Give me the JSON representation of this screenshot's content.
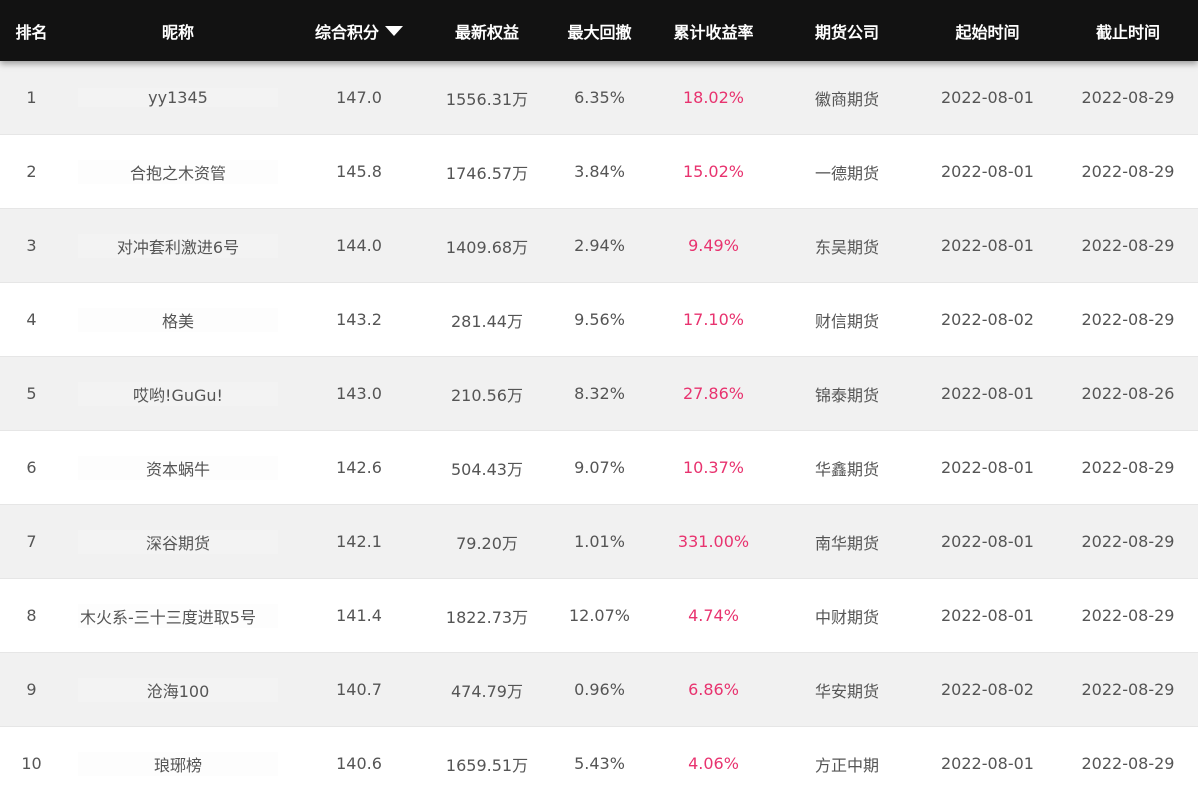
{
  "header": {
    "rank": "排名",
    "nickname": "昵称",
    "score": "综合积分",
    "equity": "最新权益",
    "drawdown": "最大回撤",
    "return": "累计收益率",
    "company": "期货公司",
    "start": "起始时间",
    "end": "截止时间",
    "sort_icon": "caret-down-icon"
  },
  "rows": [
    {
      "rank": "1",
      "nickname": "yy1345",
      "score": "147.0",
      "equity": "1556.31万",
      "drawdown": "6.35%",
      "return": "18.02%",
      "company": "徽商期货",
      "start": "2022-08-01",
      "end": "2022-08-29"
    },
    {
      "rank": "2",
      "nickname": "合抱之木资管",
      "score": "145.8",
      "equity": "1746.57万",
      "drawdown": "3.84%",
      "return": "15.02%",
      "company": "一德期货",
      "start": "2022-08-01",
      "end": "2022-08-29"
    },
    {
      "rank": "3",
      "nickname": "对冲套利激进6号",
      "score": "144.0",
      "equity": "1409.68万",
      "drawdown": "2.94%",
      "return": "9.49%",
      "company": "东吴期货",
      "start": "2022-08-01",
      "end": "2022-08-29"
    },
    {
      "rank": "4",
      "nickname": "格美",
      "score": "143.2",
      "equity": "281.44万",
      "drawdown": "9.56%",
      "return": "17.10%",
      "company": "财信期货",
      "start": "2022-08-02",
      "end": "2022-08-29"
    },
    {
      "rank": "5",
      "nickname": "哎哟!GuGu!",
      "score": "143.0",
      "equity": "210.56万",
      "drawdown": "8.32%",
      "return": "27.86%",
      "company": "锦泰期货",
      "start": "2022-08-01",
      "end": "2022-08-26"
    },
    {
      "rank": "6",
      "nickname": "资本蜗牛",
      "score": "142.6",
      "equity": "504.43万",
      "drawdown": "9.07%",
      "return": "10.37%",
      "company": "华鑫期货",
      "start": "2022-08-01",
      "end": "2022-08-29"
    },
    {
      "rank": "7",
      "nickname": "深谷期货",
      "score": "142.1",
      "equity": "79.20万",
      "drawdown": "1.01%",
      "return": "331.00%",
      "company": "南华期货",
      "start": "2022-08-01",
      "end": "2022-08-29"
    },
    {
      "rank": "8",
      "nickname": "木火系-三十三度进取5号",
      "score": "141.4",
      "equity": "1822.73万",
      "drawdown": "12.07%",
      "return": "4.74%",
      "company": "中财期货",
      "start": "2022-08-01",
      "end": "2022-08-29"
    },
    {
      "rank": "9",
      "nickname": "沧海100",
      "score": "140.7",
      "equity": "474.79万",
      "drawdown": "0.96%",
      "return": "6.86%",
      "company": "华安期货",
      "start": "2022-08-02",
      "end": "2022-08-29"
    },
    {
      "rank": "10",
      "nickname": "琅琊榜",
      "score": "140.6",
      "equity": "1659.51万",
      "drawdown": "5.43%",
      "return": "4.06%",
      "company": "方正中期",
      "start": "2022-08-01",
      "end": "2022-08-29"
    }
  ],
  "colors": {
    "header_bg": "#121212",
    "row_alt_bg": "#f1f1f1",
    "return_color": "#e8336f",
    "text_color": "#555555"
  }
}
